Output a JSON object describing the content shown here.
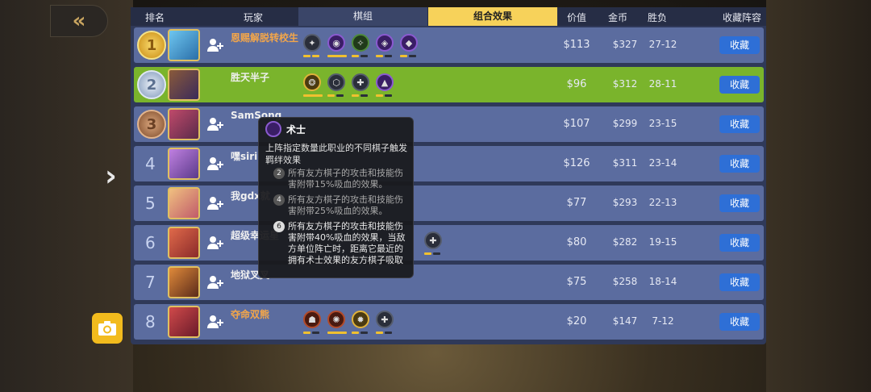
{
  "header": {
    "rank": "排名",
    "player": "玩家",
    "lineup": "棋组",
    "synergy": "组合效果",
    "value": "价值",
    "gold": "金币",
    "winloss": "胜负",
    "save_col": "收藏阵容"
  },
  "rows": [
    {
      "rank": "1",
      "name": "恩赐解脱转校生",
      "price": "$113",
      "gold": "$327",
      "wl": "27-12",
      "save": "收藏"
    },
    {
      "rank": "2",
      "name": "胜天半子",
      "price": "$96",
      "gold": "$312",
      "wl": "28-11",
      "save": "收藏"
    },
    {
      "rank": "3",
      "name": "SamSong",
      "price": "$107",
      "gold": "$299",
      "wl": "23-15",
      "save": "收藏"
    },
    {
      "rank": "4",
      "name": "嘿siri",
      "price": "$126",
      "gold": "$311",
      "wl": "23-14",
      "save": "收藏"
    },
    {
      "rank": "5",
      "name": "我gdx就",
      "price": "$77",
      "gold": "$293",
      "wl": "22-13",
      "save": "收藏"
    },
    {
      "rank": "6",
      "name": "超级幸运星",
      "price": "$80",
      "gold": "$282",
      "wl": "19-15",
      "save": "收藏"
    },
    {
      "rank": "7",
      "name": "地狱叉叉",
      "price": "$75",
      "gold": "$258",
      "wl": "18-14",
      "save": "收藏"
    },
    {
      "rank": "8",
      "name": "夺命双熊",
      "price": "$20",
      "gold": "$147",
      "wl": "7-12",
      "save": "收藏"
    }
  ],
  "tooltip": {
    "title": "术士",
    "desc": "上阵指定数量此职业的不同棋子触发羁绊效果",
    "tiers": [
      {
        "n": "2",
        "text": "所有友方棋子的攻击和技能伤害附带15%吸血的效果。"
      },
      {
        "n": "4",
        "text": "所有友方棋子的攻击和技能伤害附带25%吸血的效果。"
      },
      {
        "n": "6",
        "text": "所有友方棋子的攻击和技能伤害附带40%吸血的效果，当敌方单位阵亡时，距离它最近的拥有术士效果的友方棋子吸取"
      }
    ]
  },
  "colors": {
    "highlight_row": "#7ab42c",
    "active_tab": "#f7d25a",
    "save_button": "#2e6fd6",
    "row": "#5b6c9f"
  },
  "icons": {
    "back": "double-chevron-left-icon",
    "next": "chevron-right-icon",
    "camera": "camera-icon",
    "add_friend": "add-friend-icon"
  }
}
